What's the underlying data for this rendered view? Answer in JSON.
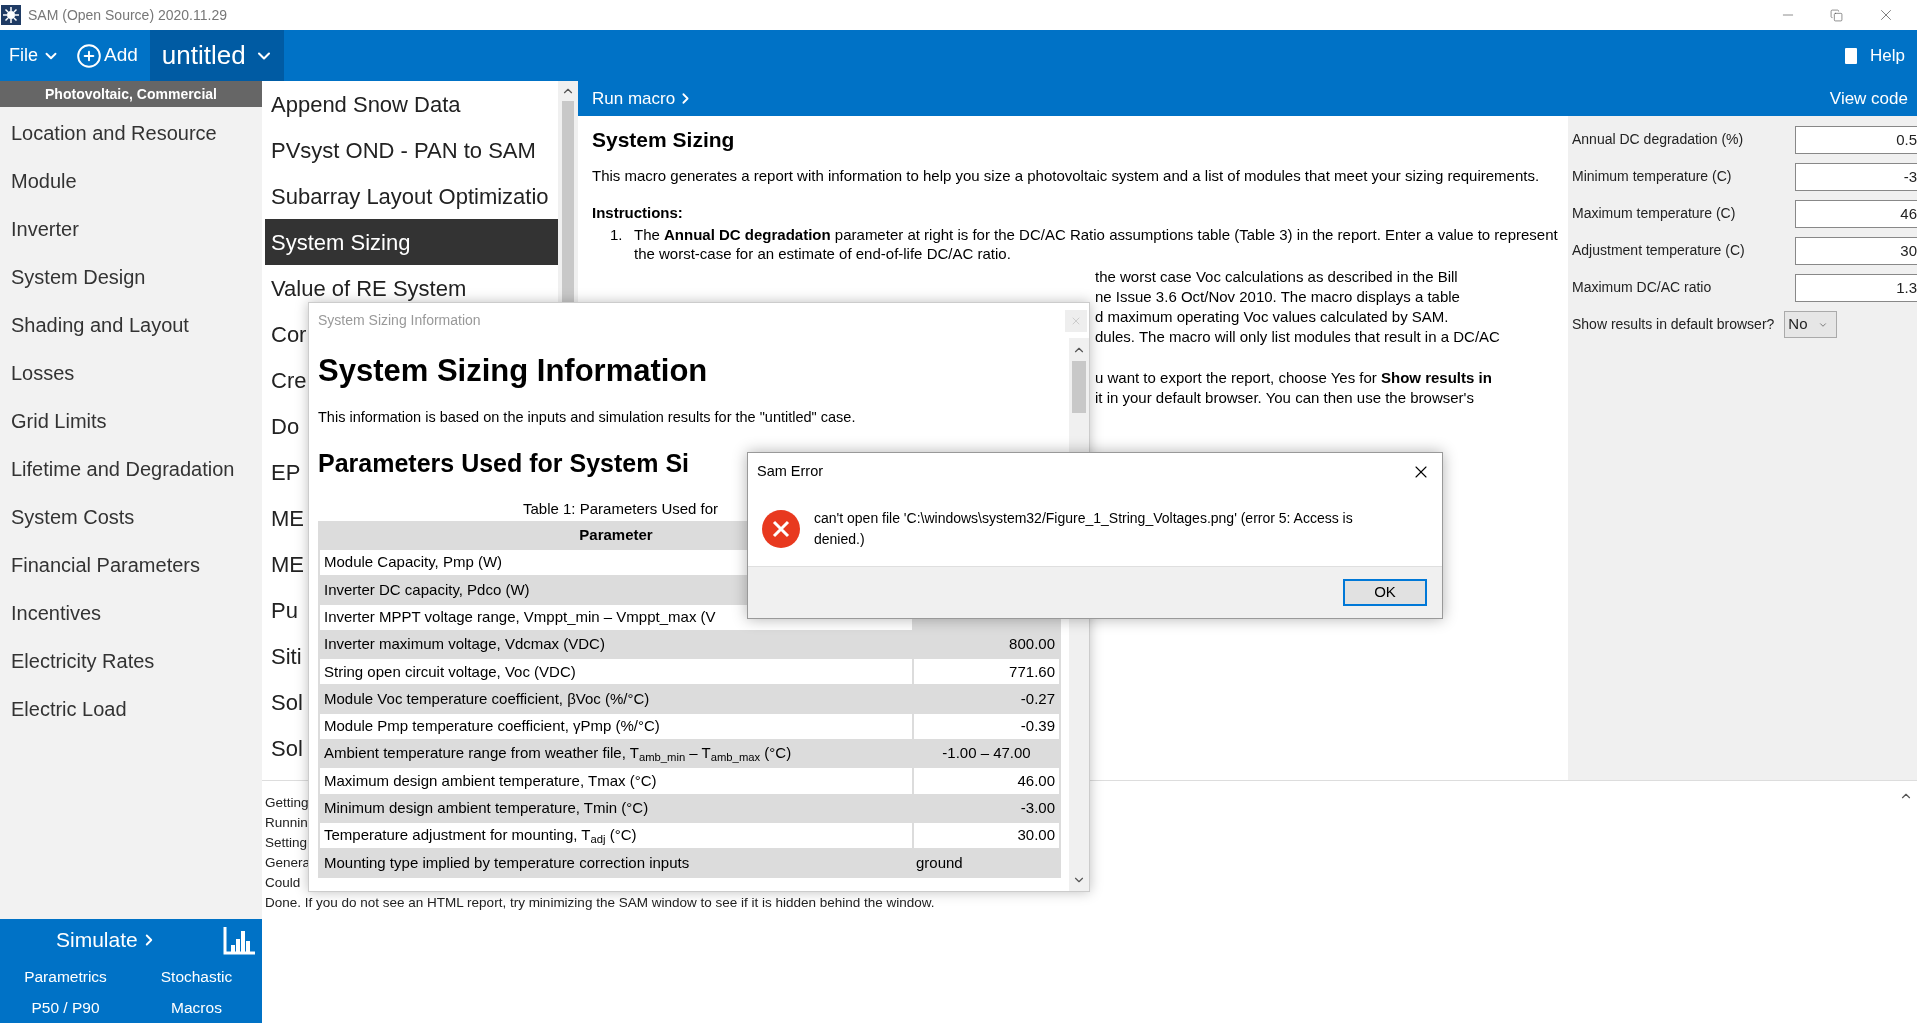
{
  "window": {
    "title": "SAM (Open Source) 2020.11.29"
  },
  "menu_bar": {
    "file": "File",
    "add": "Add",
    "case": "untitled",
    "help": "Help"
  },
  "sidebar": {
    "header": "Photovoltaic, Commercial",
    "items": [
      {
        "label": "Location and Resource"
      },
      {
        "label": "Module"
      },
      {
        "label": "Inverter"
      },
      {
        "label": "System Design"
      },
      {
        "label": "Shading and Layout"
      },
      {
        "label": "Losses"
      },
      {
        "label": "Grid Limits"
      },
      {
        "label": "Lifetime and Degradation"
      },
      {
        "label": "System Costs"
      },
      {
        "label": "Financial Parameters"
      },
      {
        "label": "Incentives"
      },
      {
        "label": "Electricity Rates"
      },
      {
        "label": "Electric Load"
      }
    ]
  },
  "simulate": {
    "label": "Simulate",
    "links": [
      "Parametrics",
      "Stochastic",
      "P50 / P90",
      "Macros"
    ]
  },
  "macros": {
    "items": [
      {
        "label": "Append Snow Data",
        "selected": false
      },
      {
        "label": "PVsyst OND - PAN to SAM",
        "selected": false
      },
      {
        "label": "Subarray Layout Optimizatio",
        "selected": false
      },
      {
        "label": "System Sizing",
        "selected": true
      },
      {
        "label": "Value of RE System",
        "selected": false
      },
      {
        "label": "Cor",
        "selected": false
      },
      {
        "label": "Cre",
        "selected": false
      },
      {
        "label": "Do",
        "selected": false
      },
      {
        "label": "EP",
        "selected": false
      },
      {
        "label": "ME",
        "selected": false
      },
      {
        "label": "ME",
        "selected": false
      },
      {
        "label": "Pu",
        "selected": false
      },
      {
        "label": "Siti",
        "selected": false
      },
      {
        "label": "Sol",
        "selected": false
      },
      {
        "label": "Sol",
        "selected": false
      }
    ]
  },
  "macro_bar": {
    "run": "Run macro",
    "view_code": "View code"
  },
  "description": {
    "title": "System Sizing",
    "intro": "This macro generates a report with information to help you size a photovoltaic system and a list of modules that meet your sizing requirements.",
    "instructions_heading": "Instructions:",
    "steps": [
      {
        "number": "1.",
        "text": "The **Annual DC degradation** parameter at right is for the DC/AC Ratio assumptions table (Table 3) in the report. Enter a value to represent the worst-case for an estimate of end-of-life DC/AC ratio."
      }
    ],
    "fragment_groups": [
      [
        "the worst case Voc calculations as described in the Bill",
        "ne Issue 3.6 Oct/Nov 2010. The macro displays a table",
        "d maximum operating Voc values calculated by SAM.",
        "dules. The macro will only list modules that result in a DC/AC"
      ],
      [
        "u want to export the report, choose Yes for **Show results in**",
        "it in your default browser. You can then use the browser's"
      ]
    ]
  },
  "inputs": [
    {
      "label": "Annual DC degradation (%)",
      "value": "0.5"
    },
    {
      "label": "Minimum temperature (C)",
      "value": "-3"
    },
    {
      "label": "Maximum temperature (C)",
      "value": "46"
    },
    {
      "label": "Adjustment temperature (C)",
      "value": "30"
    },
    {
      "label": "Maximum DC/AC ratio",
      "value": "1.3"
    }
  ],
  "browser_option": {
    "label": "Show results in default browser?",
    "value": "No"
  },
  "log": {
    "lines": [
      "Getting",
      "Runnin",
      "Setting",
      "Genera",
      "Could",
      "Done. If you do not see an HTML report, try minimizing the SAM window to see if it is hidden behind the window."
    ]
  },
  "info_dialog": {
    "title": "System Sizing Information",
    "heading": "System Sizing Information",
    "text": "This information is based on the inputs and simulation results for the \"untitled\" case.",
    "subheading": "Parameters Used for System Si",
    "caption": "Table 1: Parameters Used for",
    "columns": [
      "Parameter"
    ],
    "rows": [
      {
        "parameter": "Module Capacity, Pmp (W)"
      },
      {
        "parameter": "Inverter DC capacity, Pdco (W)"
      },
      {
        "parameter": "Inverter MPPT voltage range, Vmppt_min – Vmppt_max (V"
      },
      {
        "parameter": "Inverter maximum voltage, Vdcmax (VDC)",
        "value": "800.00",
        "kind": "number"
      },
      {
        "parameter": "String open circuit voltage, Voc (VDC)",
        "value": "771.60",
        "kind": "number"
      },
      {
        "parameter": "Module Voc temperature coefficient, βVoc (%/°C)",
        "value": "-0.27",
        "kind": "number"
      },
      {
        "parameter": "Module Pmp temperature coefficient, γPmp (%/°C)",
        "value": "-0.39",
        "kind": "number"
      },
      {
        "parameter": "Ambient temperature range from weather file, T$_{amb_min}$ – T$_{amb_max}$ (°C)",
        "value": "-1.00 – 47.00",
        "kind": "range"
      },
      {
        "parameter": "Maximum design ambient temperature, Tmax (°C)",
        "value": "46.00",
        "kind": "number"
      },
      {
        "parameter": "Minimum design ambient temperature, Tmin (°C)",
        "value": "-3.00",
        "kind": "number"
      },
      {
        "parameter": "Temperature adjustment for mounting, T$_{adj}$ (°C)",
        "value": "30.00",
        "kind": "number"
      },
      {
        "parameter": "Mounting type implied by temperature correction inputs",
        "value": "ground",
        "kind": "text"
      }
    ]
  },
  "error_dialog": {
    "title": "Sam Error",
    "message": "can't open file 'C:\\windows\\system32/Figure_1_String_Voltages.png' (error 5: Access is denied.)",
    "button": "OK"
  }
}
